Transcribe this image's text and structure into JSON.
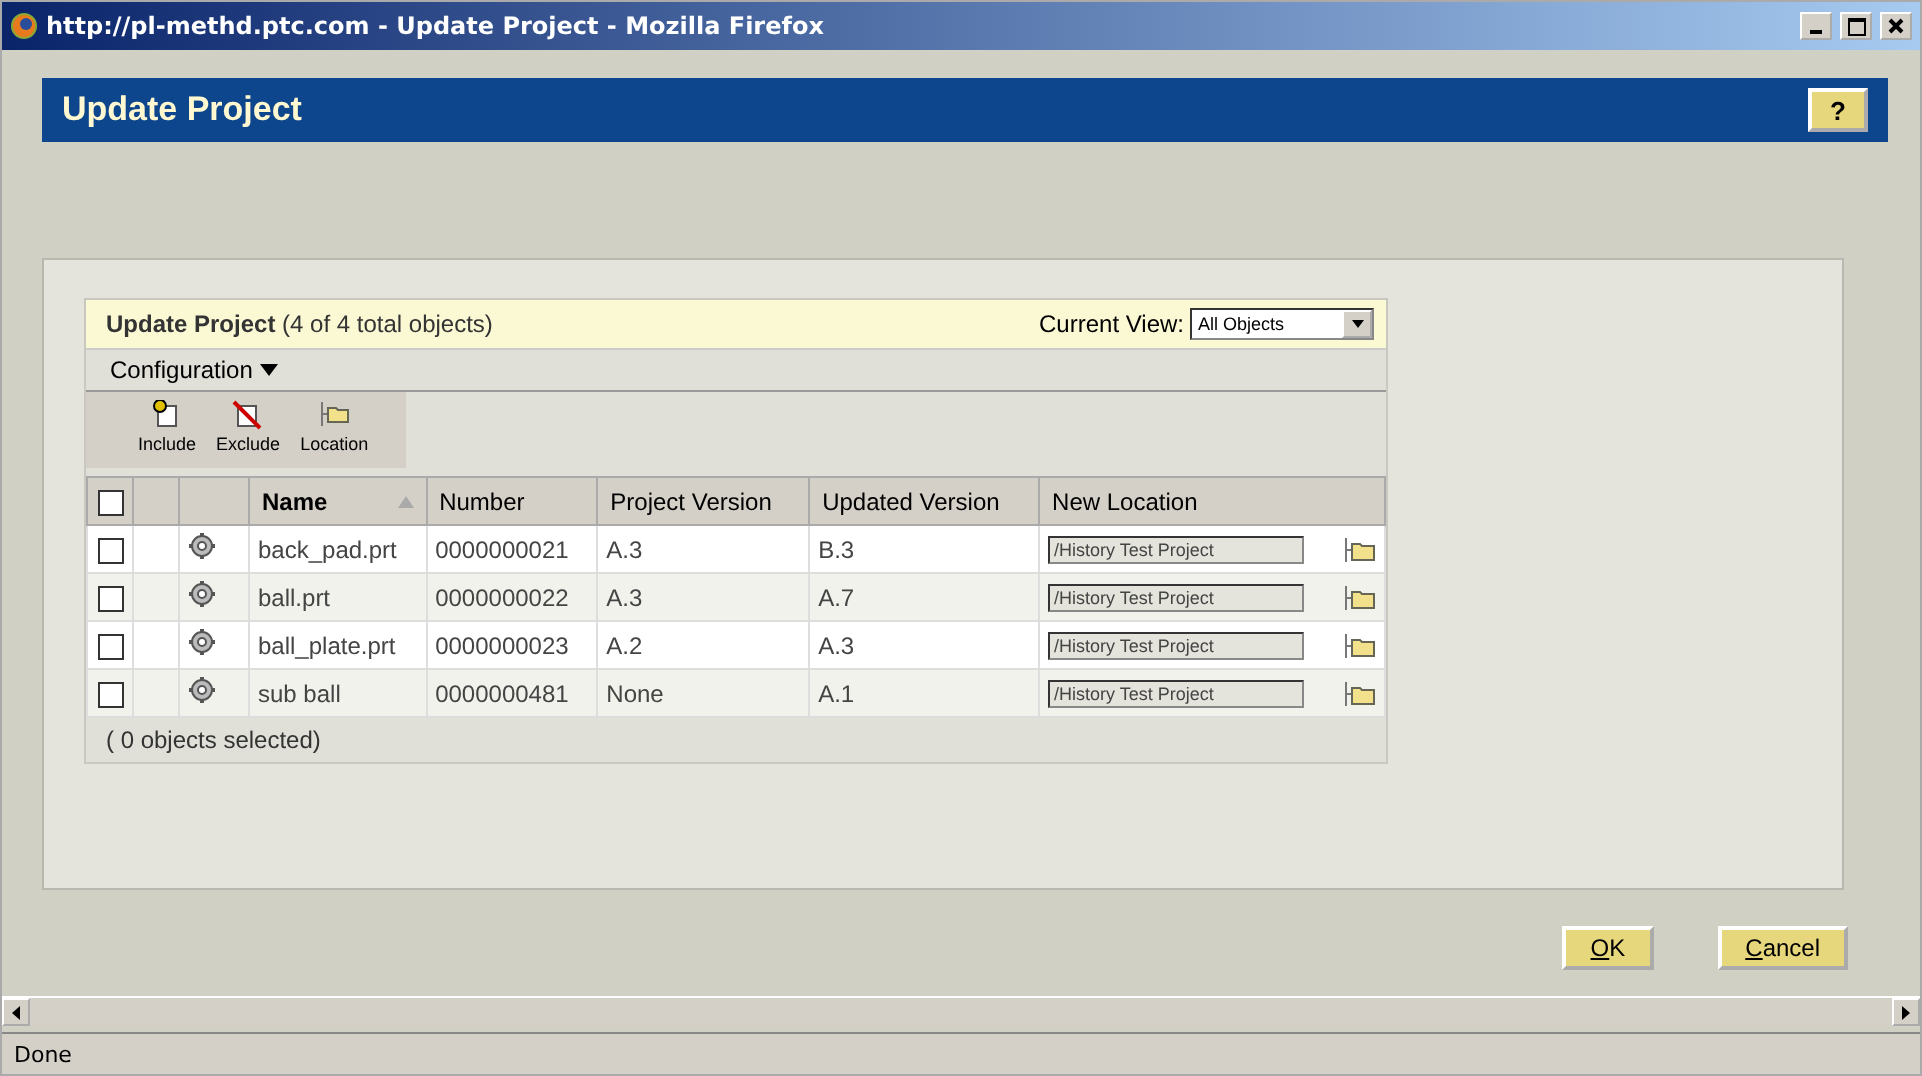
{
  "window": {
    "title": "http://pl-methd.ptc.com - Update Project - Mozilla Firefox"
  },
  "header": {
    "title": "Update Project",
    "help": "?"
  },
  "table": {
    "title": "Update Project",
    "count": "(4 of 4 total objects)",
    "view_label": "Current View:",
    "view": "All Objects",
    "menu": "Configuration",
    "tools": [
      {
        "kind": "include",
        "label": "Include"
      },
      {
        "kind": "exclude",
        "label": "Exclude"
      },
      {
        "kind": "location",
        "label": "Location"
      }
    ],
    "select_all": {
      "checked": false
    },
    "columns": [
      "Name",
      "Number",
      "Project Version",
      "Updated Version",
      "New Location"
    ],
    "rows": [
      {
        "checked": false,
        "name": "back_pad.prt",
        "number": "0000000021",
        "project_version": "A.3",
        "updated_version": "B.3",
        "location": "/History Test Project"
      },
      {
        "checked": false,
        "name": "ball.prt",
        "number": "0000000022",
        "project_version": "A.3",
        "updated_version": "A.7",
        "location": "/History Test Project"
      },
      {
        "checked": false,
        "name": "ball_plate.prt",
        "number": "0000000023",
        "project_version": "A.2",
        "updated_version": "A.3",
        "location": "/History Test Project"
      },
      {
        "checked": false,
        "name": "sub ball",
        "number": "0000000481",
        "project_version": "None",
        "updated_version": "A.1",
        "location": "/History Test Project"
      }
    ],
    "footer": "( 0 objects selected)"
  },
  "buttons": [
    "OK",
    "Cancel"
  ],
  "status_bar": "Done"
}
